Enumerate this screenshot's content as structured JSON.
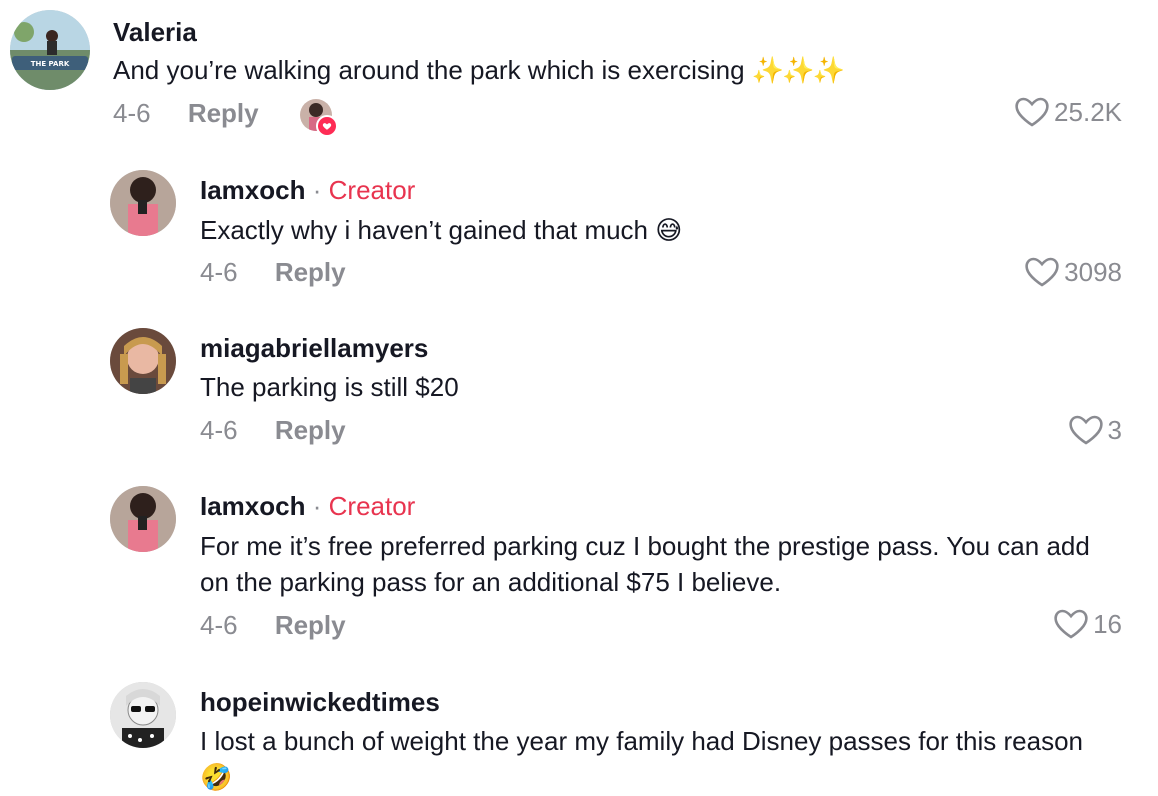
{
  "comments": [
    {
      "username": "Valeria",
      "is_creator": false,
      "text": "And you’re walking around the park which is exercising",
      "text_suffix": "✨✨✨",
      "date": "4-6",
      "reply_label": "Reply",
      "likes": "25.2K",
      "avatar_banner_text": "THE PARK"
    },
    {
      "username": "Iamxoch",
      "creator_sep": "·",
      "creator_label": "Creator",
      "text": "Exactly why i haven’t gained that much",
      "emoji": "😅",
      "date": "4-6",
      "reply_label": "Reply",
      "likes": "3098"
    },
    {
      "username": "miagabriellamyers",
      "text": "The parking is still $20",
      "date": "4-6",
      "reply_label": "Reply",
      "likes": "3"
    },
    {
      "username": "Iamxoch",
      "creator_sep": "·",
      "creator_label": "Creator",
      "text": "For me it’s free preferred parking cuz I bought the prestige pass. You can add on the parking pass for an additional $75 I believe.",
      "date": "4-6",
      "reply_label": "Reply",
      "likes": "16"
    },
    {
      "username": "hopeinwickedtimes",
      "text": "I lost a bunch of weight the year my family had Disney passes for this reason",
      "emoji": "🤣"
    }
  ],
  "colors": {
    "creator": "#e8344f",
    "muted": "#8a8b91",
    "text": "#161823",
    "like_badge": "#fe2c55"
  },
  "icons": {
    "like": "heart-outline-icon",
    "liked_by_creator": "heart-badge-icon"
  }
}
